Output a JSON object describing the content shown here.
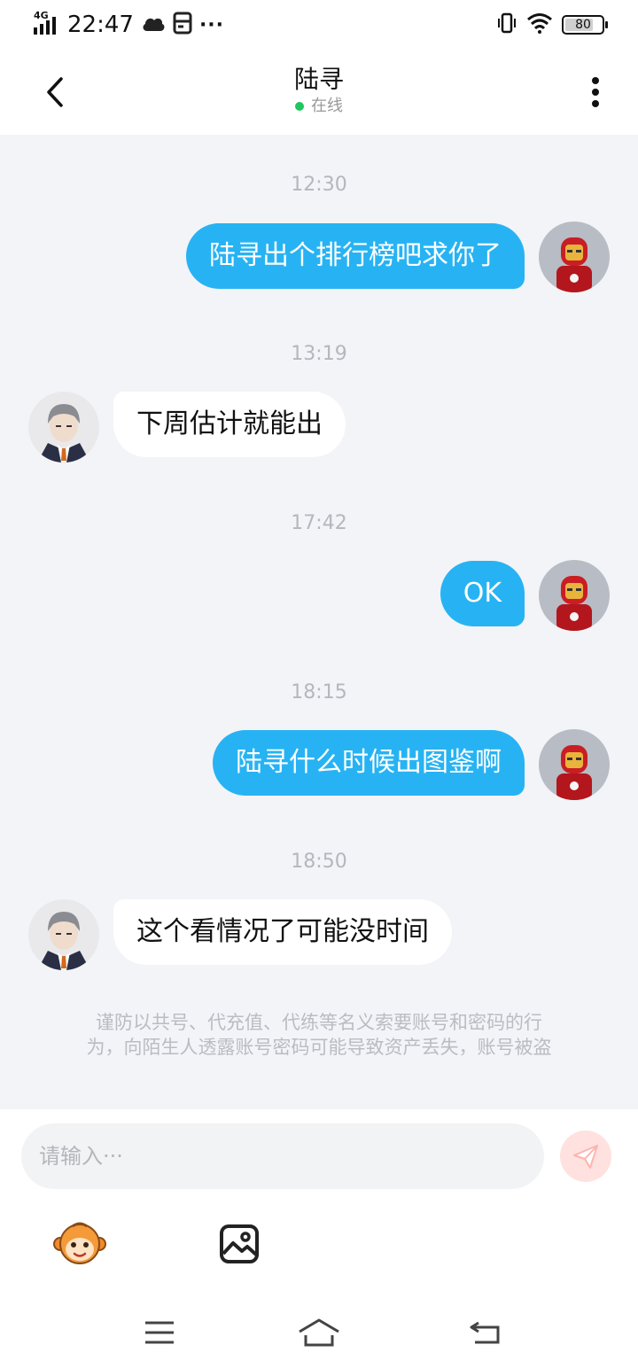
{
  "status_bar": {
    "network": "4G",
    "time": "22:47",
    "more": "···",
    "battery": "80",
    "battery_level": 0.8
  },
  "header": {
    "title": "陆寻",
    "status": "在线",
    "status_color": "#22c55e"
  },
  "messages": [
    {
      "timestamp": "12:30",
      "side": "out",
      "text": "陆寻出个排行榜吧求你了"
    },
    {
      "timestamp": "13:19",
      "side": "in",
      "text": "下周估计就能出"
    },
    {
      "timestamp": "17:42",
      "side": "out",
      "text": "OK"
    },
    {
      "timestamp": "18:15",
      "side": "out",
      "text": "陆寻什么时候出图鉴啊"
    },
    {
      "timestamp": "18:50",
      "side": "in",
      "text": "这个看情况了可能没时间"
    }
  ],
  "notice": {
    "line1": "谨防以共号、代充值、代练等名义索要账号和密码的行",
    "line2": "为，向陌生人透露账号密码可能导致资产丢失，账号被盗"
  },
  "composer": {
    "placeholder": "请输入···"
  },
  "icons": {
    "back": "chevron-left-icon",
    "more": "more-vertical-icon",
    "send": "send-icon",
    "emoji": "monkey-emoji-icon",
    "image": "image-icon"
  },
  "colors": {
    "bubble_out": "#27b3f3",
    "bubble_in": "#ffffff",
    "chat_bg": "#f2f4f7",
    "send_bg": "#ffe1df",
    "send_icon": "#ffb3ad"
  }
}
